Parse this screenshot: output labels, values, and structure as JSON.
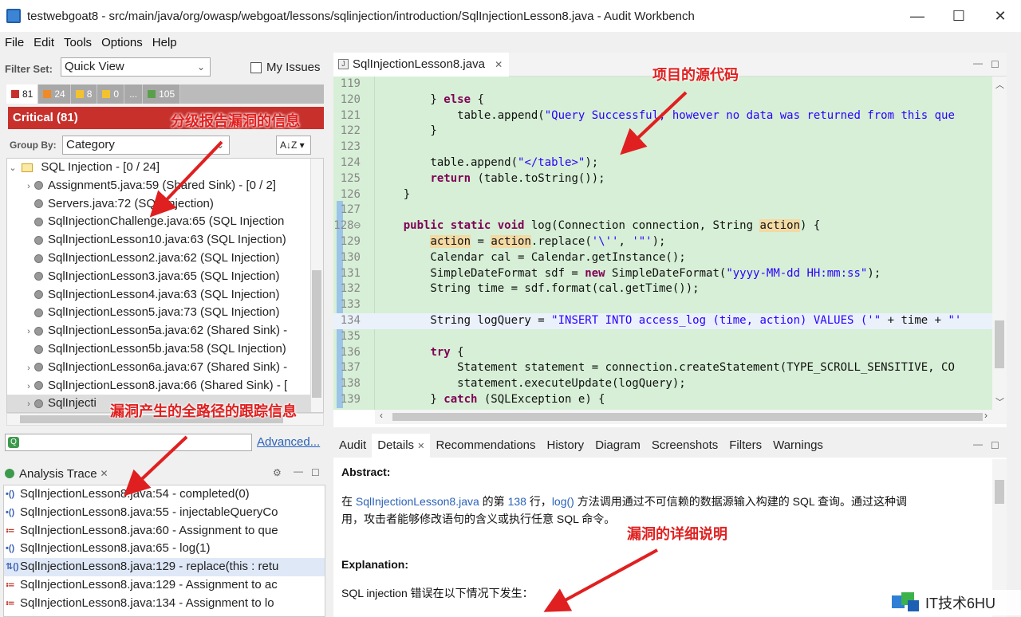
{
  "window": {
    "title": "testwebgoat8 - src/main/java/org/owasp/webgoat/lessons/sqlinjection/introduction/SqlInjectionLesson8.java - Audit Workbench",
    "controls": [
      "—",
      "☐",
      "✕"
    ]
  },
  "menu": [
    "File",
    "Edit",
    "Tools",
    "Options",
    "Help"
  ],
  "filter": {
    "label": "Filter Set:",
    "value": "Quick View",
    "my_issues": "My Issues"
  },
  "severity_tabs": [
    {
      "count": "81",
      "color": "#c8302c"
    },
    {
      "count": "24",
      "color": "#f08a24"
    },
    {
      "count": "8",
      "color": "#f2c230"
    },
    {
      "count": "0",
      "color": "#f2c230"
    },
    {
      "count": "...",
      "color": ""
    },
    {
      "count": "105",
      "color": "#5aa04a"
    }
  ],
  "critical_bar": "Critical (81)",
  "group_by": {
    "label": "Group By:",
    "value": "Category"
  },
  "tree": {
    "folder": "SQL Injection - [0 / 24]",
    "items": [
      "Assignment5.java:59 (Shared Sink) - [0 / 2]",
      "Servers.java:72 (SQL Injection)",
      "SqlInjectionChallenge.java:65 (SQL Injection",
      "SqlInjectionLesson10.java:63 (SQL Injection)",
      "SqlInjectionLesson2.java:62 (SQL Injection)",
      "SqlInjectionLesson3.java:65 (SQL Injection)",
      "SqlInjectionLesson4.java:63 (SQL Injection)",
      "SqlInjectionLesson5.java:73 (SQL Injection)",
      "SqlInjectionLesson5a.java:62 (Shared Sink) -",
      "SqlInjectionLesson5b.java:58 (SQL Injection)",
      "SqlInjectionLesson6a.java:67 (Shared Sink) -",
      "SqlInjectionLesson8.java:66 (Shared Sink) - [",
      "SqlInjecti"
    ]
  },
  "search": {
    "advanced": "Advanced..."
  },
  "trace": {
    "title": "Analysis Trace",
    "rows": [
      {
        "icon": "•()",
        "text": "SqlInjectionLesson8.java:54 - completed(0)"
      },
      {
        "icon": "•()",
        "text": "SqlInjectionLesson8.java:55 - injectableQueryCo"
      },
      {
        "icon": "≔",
        "text": "SqlInjectionLesson8.java:60 - Assignment to que"
      },
      {
        "icon": "•()",
        "text": "SqlInjectionLesson8.java:65 - log(1)"
      },
      {
        "icon": "⇅()",
        "text": "SqlInjectionLesson8.java:129 - replace(this : retu"
      },
      {
        "icon": "≔",
        "text": "SqlInjectionLesson8.java:129 - Assignment to ac"
      },
      {
        "icon": "≔",
        "text": "SqlInjectionLesson8.java:134 - Assignment to lo"
      }
    ]
  },
  "editor": {
    "tab": "SqlInjectionLesson8.java",
    "lines": [
      {
        "n": "119",
        "html": ""
      },
      {
        "n": "120",
        "html": "        } <span class=\"kw\">else</span> {"
      },
      {
        "n": "121",
        "html": "            table.append(<span class=\"str\">\"Query Successful; however no data was returned from this que</span>"
      },
      {
        "n": "122",
        "html": "        }"
      },
      {
        "n": "123",
        "html": ""
      },
      {
        "n": "124",
        "html": "        table.append(<span class=\"str\">\"&lt;/table&gt;\"</span>);"
      },
      {
        "n": "125",
        "html": "        <span class=\"kw\">return</span> (table.toString());"
      },
      {
        "n": "126",
        "html": "    }"
      },
      {
        "n": "127",
        "html": ""
      },
      {
        "n": "128⊖",
        "html": "    <span class=\"kw\">public static void</span> log(Connection connection, String <span class=\"hlw\">action</span>) {"
      },
      {
        "n": "129",
        "html": "        <span class=\"hlw\">action</span> = <span class=\"hlw\">action</span>.replace(<span class=\"str\">'\\''</span>, <span class=\"str\">'\"'</span>);"
      },
      {
        "n": "130",
        "html": "        Calendar cal = Calendar.getInstance();"
      },
      {
        "n": "131",
        "html": "        SimpleDateFormat sdf = <span class=\"kw\">new</span> SimpleDateFormat(<span class=\"str\">\"yyyy-MM-dd HH:mm:ss\"</span>);"
      },
      {
        "n": "132",
        "html": "        String time = sdf.format(cal.getTime());"
      },
      {
        "n": "133",
        "html": ""
      },
      {
        "n": "134",
        "html": "        String logQuery = <span class=\"str\">\"INSERT INTO access_log (time, action) VALUES ('\"</span> + time + <span class=\"str\">\"'</span>"
      },
      {
        "n": "135",
        "html": ""
      },
      {
        "n": "136",
        "html": "        <span class=\"kw\">try</span> {"
      },
      {
        "n": "137",
        "html": "            Statement statement = connection.createStatement(TYPE_SCROLL_SENSITIVE, CO"
      },
      {
        "n": "138",
        "html": "            statement.executeUpdate(logQuery);"
      },
      {
        "n": "139",
        "html": "        } <span class=\"kw\">catch</span> (SQLException e) {"
      }
    ]
  },
  "details": {
    "tabs": [
      "Audit",
      "Details",
      "Recommendations",
      "History",
      "Diagram",
      "Screenshots",
      "Filters",
      "Warnings"
    ],
    "abstract_title": "Abstract:",
    "abstract_pre": "在 ",
    "abstract_link1": "SqlInjectionLesson8.java",
    "abstract_mid1": " 的第 ",
    "abstract_line": "138",
    "abstract_mid2": " 行，",
    "abstract_link2": "log()",
    "abstract_post": " 方法调用通过不可信赖的数据源输入构建的 SQL 查询。通过这种调",
    "abstract_line2": "用，攻击者能够修改语句的含义或执行任意 SQL 命令。",
    "explanation_title": "Explanation:",
    "explanation_text": "SQL injection 错误在以下情况下发生："
  },
  "annotations": {
    "source": "项目的源代码",
    "levels": "分级报告漏洞的信息",
    "trace": "漏洞产生的全路径的跟踪信息",
    "detail": "漏洞的详细说明"
  },
  "watermark": "IT技术6HU"
}
